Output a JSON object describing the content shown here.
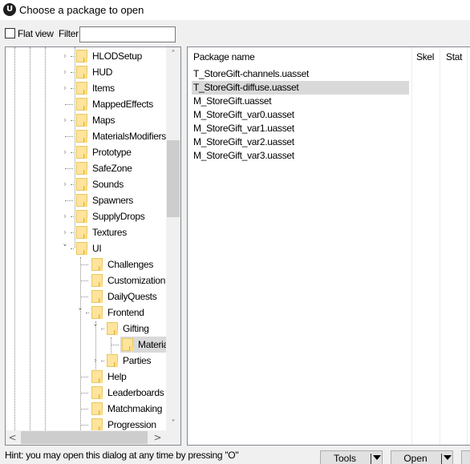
{
  "window": {
    "title": "Choose a package to open",
    "logo_glyph": "U"
  },
  "toolbar": {
    "flat_view_label": "Flat view",
    "flat_view_checked": false,
    "filter_label": "Filter:",
    "filter_value": "",
    "filter_placeholder": ""
  },
  "tree": {
    "scroll_up_glyph": "˄",
    "scroll_down_glyph": "˅",
    "scroll_left_glyph": "<",
    "scroll_right_glyph": ">",
    "items": [
      {
        "label": "HLODSetup",
        "depth": 0,
        "expander": "collapsed"
      },
      {
        "label": "HUD",
        "depth": 0,
        "expander": "collapsed"
      },
      {
        "label": "Items",
        "depth": 0,
        "expander": "collapsed"
      },
      {
        "label": "MappedEffects",
        "depth": 0,
        "expander": "none"
      },
      {
        "label": "Maps",
        "depth": 0,
        "expander": "collapsed"
      },
      {
        "label": "MaterialsModifiers",
        "depth": 0,
        "expander": "none"
      },
      {
        "label": "Prototype",
        "depth": 0,
        "expander": "collapsed"
      },
      {
        "label": "SafeZone",
        "depth": 0,
        "expander": "none"
      },
      {
        "label": "Sounds",
        "depth": 0,
        "expander": "collapsed"
      },
      {
        "label": "Spawners",
        "depth": 0,
        "expander": "none"
      },
      {
        "label": "SupplyDrops",
        "depth": 0,
        "expander": "collapsed"
      },
      {
        "label": "Textures",
        "depth": 0,
        "expander": "collapsed"
      },
      {
        "label": "UI",
        "depth": 0,
        "expander": "expanded"
      },
      {
        "label": "Challenges",
        "depth": 1,
        "expander": "none"
      },
      {
        "label": "Customization",
        "depth": 1,
        "expander": "none"
      },
      {
        "label": "DailyQuests",
        "depth": 1,
        "expander": "none"
      },
      {
        "label": "Frontend",
        "depth": 1,
        "expander": "expanded"
      },
      {
        "label": "Gifting",
        "depth": 2,
        "expander": "expanded"
      },
      {
        "label": "Materials",
        "depth": 3,
        "expander": "none",
        "selected": true
      },
      {
        "label": "Parties",
        "depth": 2,
        "expander": "collapsed"
      },
      {
        "label": "Help",
        "depth": 1,
        "expander": "none"
      },
      {
        "label": "Leaderboards",
        "depth": 1,
        "expander": "none"
      },
      {
        "label": "Matchmaking",
        "depth": 1,
        "expander": "none"
      },
      {
        "label": "Progression",
        "depth": 1,
        "expander": "none"
      }
    ]
  },
  "list": {
    "columns": [
      "Package name",
      "Skel",
      "Stat"
    ],
    "rows": [
      {
        "name": "T_StoreGift-channels.uasset",
        "selected": false
      },
      {
        "name": "T_StoreGift-diffuse.uasset",
        "selected": true
      },
      {
        "name": "M_StoreGift.uasset",
        "selected": false
      },
      {
        "name": "M_StoreGift_var0.uasset",
        "selected": false
      },
      {
        "name": "M_StoreGift_var1.uasset",
        "selected": false
      },
      {
        "name": "M_StoreGift_var2.uasset",
        "selected": false
      },
      {
        "name": "M_StoreGift_var3.uasset",
        "selected": false
      }
    ]
  },
  "footer": {
    "hint": "Hint: you may open this dialog at any time by pressing \"O\"",
    "tools_label": "Tools",
    "open_label": "Open"
  }
}
